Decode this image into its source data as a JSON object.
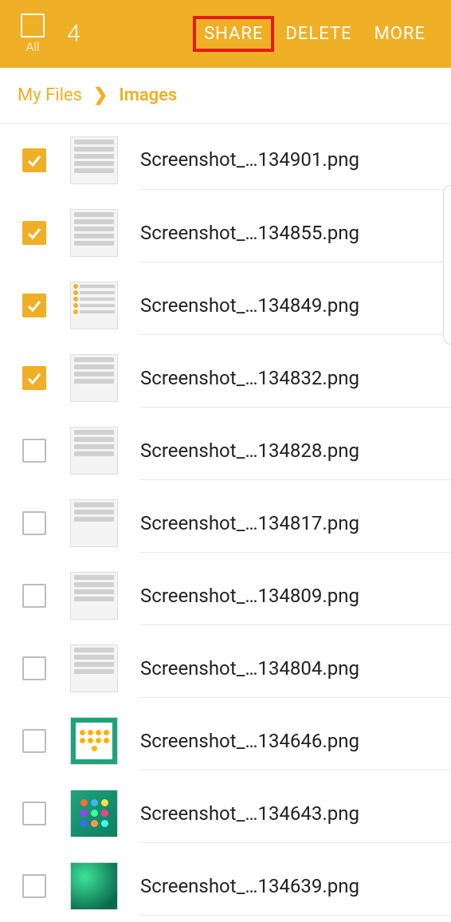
{
  "header": {
    "select_all_label": "All",
    "selection_count": "4",
    "actions": {
      "share": "SHARE",
      "delete": "DELETE",
      "more": "MORE"
    }
  },
  "breadcrumb": {
    "root": "My Files",
    "current": "Images"
  },
  "files": [
    {
      "checked": true,
      "name": "Screenshot_…134901.png"
    },
    {
      "checked": true,
      "name": "Screenshot_…134855.png"
    },
    {
      "checked": true,
      "name": "Screenshot_…134849.png"
    },
    {
      "checked": true,
      "name": "Screenshot_…134832.png"
    },
    {
      "checked": false,
      "name": "Screenshot_…134828.png"
    },
    {
      "checked": false,
      "name": "Screenshot_…134817.png"
    },
    {
      "checked": false,
      "name": "Screenshot_…134809.png"
    },
    {
      "checked": false,
      "name": "Screenshot_…134804.png"
    },
    {
      "checked": false,
      "name": "Screenshot_…134646.png"
    },
    {
      "checked": false,
      "name": "Screenshot_…134643.png"
    },
    {
      "checked": false,
      "name": "Screenshot_…134639.png"
    }
  ]
}
